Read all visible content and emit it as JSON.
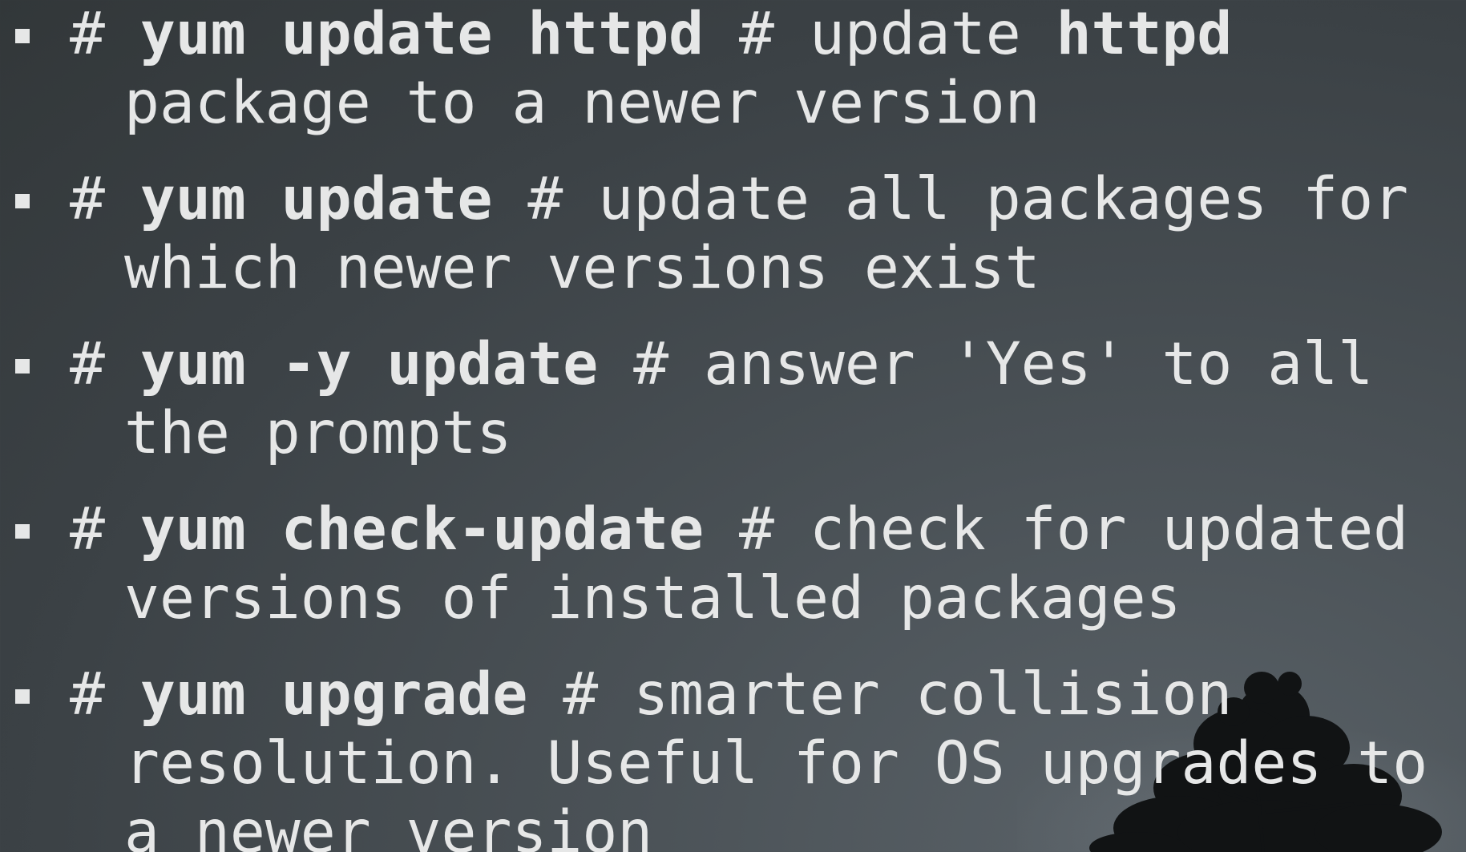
{
  "items": [
    {
      "prefix": "# ",
      "command": "yum update httpd",
      "comment": " # update ",
      "bold_word": "httpd",
      "rest": " package to a newer version"
    },
    {
      "prefix": "# ",
      "command": "yum update",
      "comment": " # update all packages for which newer versions exist"
    },
    {
      "prefix": "# ",
      "command": "yum -y update",
      "comment": " # answer 'Yes' to all the prompts"
    },
    {
      "prefix": "# ",
      "command": "yum check-update",
      "comment": " # check for updated versions of installed packages"
    },
    {
      "prefix": "# ",
      "command": "yum upgrade",
      "comment": " # smarter collision resolution. Useful for OS upgrades to a newer version"
    }
  ],
  "colors": {
    "text": "#e6e7e7",
    "background": "#3b4145"
  },
  "icons": {
    "bullet": "square-bullet-icon",
    "decoration": "tree-silhouette-icon"
  }
}
